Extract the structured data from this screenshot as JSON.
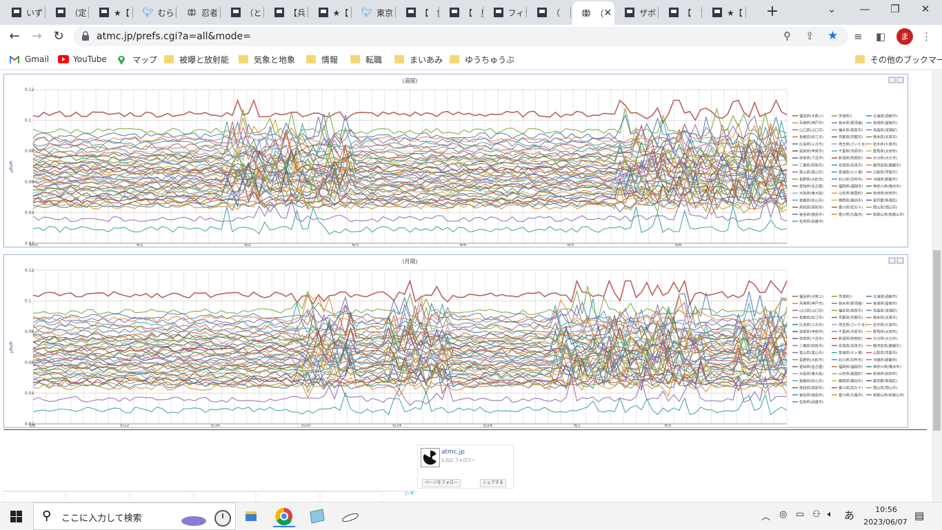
{
  "tabs": [
    {
      "label": "いず",
      "icon": "site-icon"
    },
    {
      "label": "（定",
      "icon": "site-icon"
    },
    {
      "label": "★【",
      "icon": "site-icon"
    },
    {
      "label": "むらこ",
      "icon": "twitter-icon"
    },
    {
      "label": "忍者",
      "icon": "globe-icon"
    },
    {
      "label": "（と",
      "icon": "site-icon"
    },
    {
      "label": "【兵",
      "icon": "site-icon"
    },
    {
      "label": "★【",
      "icon": "site-icon"
    },
    {
      "label": "東京",
      "icon": "twitter-icon"
    },
    {
      "label": "【　釒",
      "icon": "site-icon"
    },
    {
      "label": "【　㚖",
      "icon": "site-icon"
    },
    {
      "label": "フィラ",
      "icon": "site-icon"
    },
    {
      "label": "（",
      "icon": "site-icon"
    },
    {
      "label": "（",
      "icon": "globe-icon",
      "active": true
    },
    {
      "label": "ザボ",
      "icon": "site-icon"
    },
    {
      "label": "【　フ",
      "icon": "site-icon"
    },
    {
      "label": "★【",
      "icon": "site-icon"
    }
  ],
  "address": {
    "url": "atmc.jp/prefs.cgi?a=all&mode="
  },
  "profile_initial": "ま",
  "bookmarks": [
    {
      "label": "Gmail",
      "icon": "gmail-icon"
    },
    {
      "label": "YouTube",
      "icon": "youtube-icon"
    },
    {
      "label": "マップ",
      "icon": "maps-icon"
    },
    {
      "label": "被曝と放射能",
      "icon": "folder-icon"
    },
    {
      "label": "気象と地象",
      "icon": "folder-icon"
    },
    {
      "label": "情報",
      "icon": "folder-icon"
    },
    {
      "label": "転職",
      "icon": "folder-icon"
    },
    {
      "label": "まいあみ",
      "icon": "folder-icon"
    },
    {
      "label": "ゆうちゅうぶ",
      "icon": "folder-icon"
    }
  ],
  "other_bookmarks": "その他のブックマーク",
  "legend": [
    "福島県(大熊三)",
    "茨城県()",
    "北海道(函館市)",
    "兵庫県(神戸市)",
    "栃木県(那須塩)",
    "宮城県(留萌市)",
    "山口県(山口市)",
    "福井県(敦賀市)",
    "青森県(深浦町)",
    "島根県(松江市)",
    "京都府(京都市)",
    "熊本県(天草市)",
    "広島県(三次市)",
    "埼玉県(さいたま)",
    "岩手県(久慈市)",
    "滋賀県(甲賀市)",
    "千葉県(市原市)",
    "群馬県(太田市)",
    "岐阜県(下呂市)",
    "新潟県(阿賀町)",
    "大分県(大分市)",
    "三重県(阿賀市)",
    "奈良県(奈良市)",
    "鹿児島県(鹿屋市)",
    "富山県(富山市)",
    "宮城県(七ヶ宿)",
    "山梨県(甲斐市)",
    "長野県(大町市)",
    "石川県(羽咋市)",
    "沖縄県(那覇市)",
    "愛知県(名古屋)",
    "福岡県(福岡市)",
    "神奈川県(横浜市)",
    "大阪府(東大阪)",
    "山形県(飯豊町)",
    "秋田県(秋田市)",
    "愛媛県(松山市)",
    "静岡県(磐田市)",
    "東京都(新宿区)",
    "高知県(高知市)",
    "香川県(四万十)",
    "岡山県(岡山市)",
    "徳島県(徳島市)",
    "香川県(丸亀市)",
    "和歌山県(和歌山市)",
    "佐賀県(武雄市)"
  ],
  "charts": [
    {
      "title": "(週間)",
      "ylabel": "μSv/h",
      "yticks": [
        "0.12",
        "0.1",
        "0.08",
        "0.06",
        "0.04",
        "0.02"
      ],
      "xticks": [
        "5/31",
        "6/1",
        "6/2",
        "6/3",
        "6/4",
        "6/5",
        "6/6"
      ]
    },
    {
      "title": "(月間)",
      "ylabel": "μSv/h",
      "yticks": [
        "0.12",
        "0.1",
        "0.08",
        "0.06",
        "0.04",
        "0.02"
      ],
      "xticks": [
        "5/8",
        "5/12",
        "5/16",
        "5/20",
        "5/24",
        "5/28",
        "6/1",
        "6/5"
      ]
    }
  ],
  "chart_data": [
    {
      "type": "line",
      "title": "(週間)",
      "ylabel": "μSv/h",
      "ylim": [
        0.02,
        0.12
      ],
      "x": [
        "5/31",
        "6/1",
        "6/2",
        "6/3",
        "6/4",
        "6/5",
        "6/6"
      ],
      "series_count": 46,
      "baseline_levels": [
        0.104,
        0.093,
        0.09,
        0.088,
        0.087,
        0.085,
        0.083,
        0.082,
        0.08,
        0.078,
        0.077,
        0.076,
        0.075,
        0.074,
        0.073,
        0.072,
        0.071,
        0.07,
        0.069,
        0.068,
        0.067,
        0.066,
        0.065,
        0.064,
        0.063,
        0.062,
        0.061,
        0.06,
        0.059,
        0.058,
        0.057,
        0.056,
        0.055,
        0.054,
        0.053,
        0.052,
        0.051,
        0.05,
        0.049,
        0.048,
        0.047,
        0.046,
        0.045,
        0.044,
        0.036,
        0.029
      ],
      "grid": true,
      "legend": "right"
    },
    {
      "type": "line",
      "title": "(月間)",
      "ylabel": "μSv/h",
      "ylim": [
        0.02,
        0.12
      ],
      "x": [
        "5/8",
        "5/12",
        "5/16",
        "5/20",
        "5/24",
        "5/28",
        "6/1",
        "6/5"
      ],
      "series_count": 46,
      "baseline_levels": [
        0.104,
        0.093,
        0.09,
        0.088,
        0.087,
        0.085,
        0.083,
        0.082,
        0.08,
        0.078,
        0.077,
        0.076,
        0.075,
        0.074,
        0.073,
        0.072,
        0.071,
        0.07,
        0.069,
        0.068,
        0.067,
        0.066,
        0.065,
        0.064,
        0.063,
        0.062,
        0.061,
        0.06,
        0.059,
        0.058,
        0.057,
        0.056,
        0.055,
        0.054,
        0.053,
        0.052,
        0.051,
        0.05,
        0.049,
        0.048,
        0.047,
        0.046,
        0.045,
        0.044,
        0.036,
        0.029
      ],
      "grid": true,
      "legend": "right"
    }
  ],
  "series_colors": [
    "#b35050",
    "#7aa33a",
    "#4a7ab5",
    "#e08a2e",
    "#8a6ab0",
    "#3aa0a0",
    "#c05a80",
    "#9a9a40",
    "#5a8ad0",
    "#d0703a",
    "#6a6a6a",
    "#b07a3a",
    "#3a8a5a",
    "#a0a0d0",
    "#d0a040",
    "#805050",
    "#50a0c0",
    "#c0c040",
    "#7050a0",
    "#a05030"
  ],
  "fb": {
    "name": "atmc.jp",
    "followers": "5,322 フォロワー",
    "follow_label": "ページをフォロー",
    "share_label": "シェアする"
  },
  "taskbar": {
    "search_placeholder": "ここに入力して検索",
    "time": "10:56",
    "date": "2023/06/07",
    "ime": "あ"
  }
}
